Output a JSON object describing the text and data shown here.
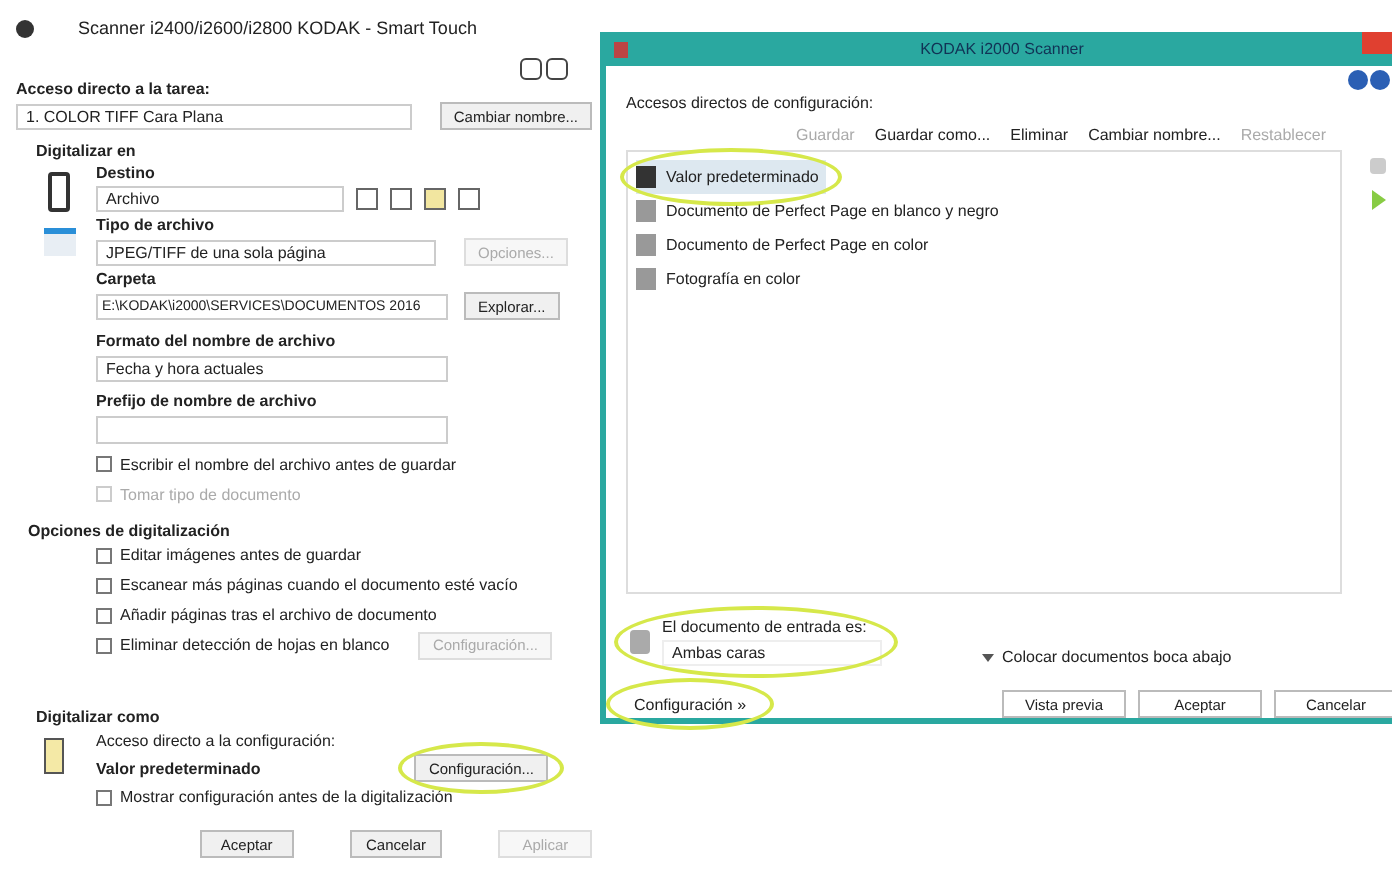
{
  "left_window": {
    "title": "Scanner i2400/i2600/i2800 KODAK - Smart Touch",
    "shortcut_label": "Acceso directo a la tarea:",
    "shortcut_value": "1. COLOR TIFF Cara Plana",
    "rename_button": "Cambiar nombre...",
    "scan_to_heading": "Digitalizar en",
    "destination_label": "Destino",
    "destination_value": "Archivo",
    "file_type_label": "Tipo de archivo",
    "file_type_value": "JPEG/TIFF de una sola página",
    "file_options_button": {
      "label": "Opciones...",
      "disabled": true
    },
    "folder_label": "Carpeta",
    "folder_value": "E:\\KODAK\\i2000\\SERVICES\\DOCUMENTOS 2016",
    "browse_button": "Explorar...",
    "name_format_label": "Formato del nombre de archivo",
    "name_format_value": "Fecha y hora actuales",
    "prefix_label": "Prefijo de nombre de archivo",
    "file_checks": [
      {
        "label": "Escribir el nombre del archivo antes de guardar",
        "checked": false,
        "disabled": false
      },
      {
        "label": "Tomar tipo de documento",
        "checked": false,
        "disabled": true
      }
    ],
    "scan_options_heading": "Opciones de digitalización",
    "scan_options": [
      {
        "label": "Editar imágenes antes de guardar",
        "checked": false
      },
      {
        "label": "Escanear más páginas cuando el documento esté vacío",
        "checked": false
      },
      {
        "label": "Añadir páginas tras el archivo de documento",
        "checked": false
      },
      {
        "label": "Eliminar detección de hojas en blanco",
        "checked": false
      }
    ],
    "scan_options_button": {
      "label": "Configuración...",
      "disabled": true
    },
    "scan_as_heading": "Digitalizar como",
    "scan_as_label": "Acceso directo a la configuración:",
    "scan_as_value": "Valor predeterminado",
    "settings_button": {
      "label": "Configuración...",
      "highlighted": true
    },
    "show_settings": {
      "label": "Mostrar configuración antes de la digitalización",
      "checked": false
    },
    "buttons": [
      {
        "label": "Aceptar",
        "disabled": false
      },
      {
        "label": "Cancelar",
        "disabled": false
      },
      {
        "label": "Aplicar",
        "disabled": true
      }
    ]
  },
  "right_window": {
    "title": "KODAK i2000 Scanner",
    "shortcuts_label": "Accesos directos de configuración:",
    "toolbar": [
      {
        "label": "Guardar",
        "disabled": true
      },
      {
        "label": "Guardar como...",
        "disabled": false
      },
      {
        "label": "Eliminar",
        "disabled": false
      },
      {
        "label": "Cambiar nombre...",
        "disabled": false
      },
      {
        "label": "Restablecer",
        "disabled": true
      }
    ],
    "shortcuts": [
      {
        "label": "Valor predeterminado",
        "selected": true,
        "highlighted": true
      },
      {
        "label": "Documento de Perfect Page en blanco y negro",
        "selected": false,
        "highlighted": false
      },
      {
        "label": "Documento de Perfect Page en color",
        "selected": false,
        "highlighted": false
      },
      {
        "label": "Fotografía en color",
        "selected": false,
        "highlighted": false
      }
    ],
    "input_label": "El documento de entrada es:",
    "input_value": "Ambas caras",
    "input_highlighted": true,
    "placement": "Colocar documentos boca abajo",
    "settings_button": {
      "label": "Configuración »",
      "highlighted": true
    },
    "buttons": [
      "Vista previa",
      "Aceptar",
      "Cancelar"
    ]
  }
}
